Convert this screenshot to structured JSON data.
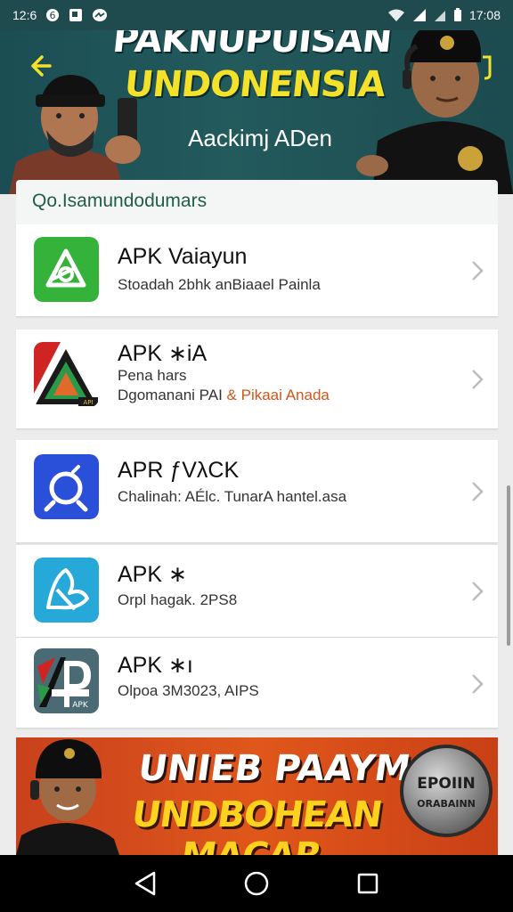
{
  "status_bar": {
    "time_left": "12:6",
    "time_right": "17:08",
    "icons_left": [
      "circle-six-icon",
      "gallery-icon",
      "messenger-icon"
    ],
    "icons_right": [
      "wifi-icon",
      "signal-icon",
      "signal-icon-2",
      "battery-icon"
    ]
  },
  "hero": {
    "title_line1": "PAKNUPUISAN",
    "title_line2": "UNDONENSIA",
    "subtitle": "Aackimj ADen",
    "back_icon": "back-arrow-icon",
    "forward_icon": "forward-icon"
  },
  "section": {
    "title": "Qo.Isamundodumars"
  },
  "apps": [
    {
      "name": "APK Vaiayun",
      "desc": "Stoadah 2bhk anBiaael Painla",
      "icon": "triangle-loop-icon",
      "icon_color": "#3cb43c"
    },
    {
      "name": "APK ∗iA",
      "desc_line1": "Pena hars",
      "desc_line2": "Dgomanani PAI",
      "desc_accent": "& Pikaai Anada",
      "icon": "tricolor-triangle-icon",
      "icon_color": "#c82828"
    },
    {
      "name": "APR ƒVλCK",
      "desc": "Chalinah: AÉlc. TunarA hantel.asa",
      "icon": "search-magnifier-icon",
      "icon_color": "#2a4fd8"
    },
    {
      "name": "APK ∗",
      "desc": "Orpl hagak. 2PS8",
      "icon": "hand-stroke-icon",
      "icon_color": "#2aa8d8"
    },
    {
      "name": "APK ∗ı",
      "desc": "Olpoa 3M3023, AIPS",
      "icon": "ap-logo-icon",
      "icon_color": "#4a6a74"
    }
  ],
  "promo": {
    "line1": "UNIEB PAAYM",
    "line2": "UNDBOHEAN MACAR",
    "badge_line1": "EPOIIN",
    "badge_line2": "ORABAINN"
  },
  "nav": {
    "back": "back-triangle-icon",
    "home": "home-circle-icon",
    "recents": "recents-square-icon"
  }
}
